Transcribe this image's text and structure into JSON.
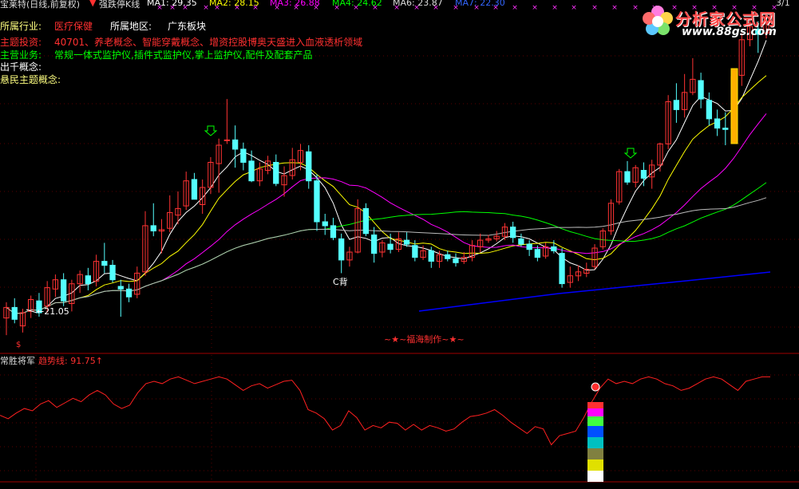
{
  "header": {
    "title": "宝莱特(日线,前复权)",
    "indicator": "强跌停K线",
    "ma1": "MA1: 29.35",
    "ma2": "MA2: 28.15",
    "ma3": "MA3: 26.88",
    "ma4": "MA4: 24.62",
    "ma6": "MA6: 23.87",
    "ma7": "MA7: 22.30",
    "corner": "3/1"
  },
  "info": {
    "industry_label": "所属行业:",
    "industry_value": "医疗保健",
    "region_label": "所属地区:",
    "region_value": "广东板块",
    "theme_label": "主题投资:",
    "theme_value": "40701、养老概念、智能穿戴概念、增资控股博奥天盛进入血液透析领域",
    "business_label": "主营业务:",
    "business_value": "常规一体式监护仪,插件式监护仪,掌上监护仪,配件及配套产品",
    "chuqian_label": "出千概念:",
    "youmin_label": "悬民主题概念:"
  },
  "logo": {
    "name": "分析家公式网",
    "url": "www.88gs.com"
  },
  "annotations": {
    "low_price": "←21.05",
    "c_back": "C背",
    "credit": "~★~福海制作~★~",
    "dollar": "$"
  },
  "lower_panel": {
    "name": "常胜将军",
    "trend_label": "趋势线:",
    "trend_value": "91.75",
    "trend_arrow": "↑"
  },
  "colors": {
    "ma1": "#ffffff",
    "ma2": "#ffff00",
    "ma3": "#ff00ff",
    "ma4": "#00ff00",
    "ma6": "#0000ff",
    "ma7": "#3366ff",
    "up": "#ff3333",
    "down": "#54ffff",
    "industry": "#ff3030",
    "business": "#00ff00",
    "grid": "#800000"
  },
  "chart_data": {
    "type": "candlestick",
    "candles": [
      {
        "o": 23.0,
        "h": 24.2,
        "l": 21.7,
        "c": 23.8
      },
      {
        "o": 23.8,
        "h": 24.5,
        "l": 22.6,
        "c": 22.9
      },
      {
        "o": 22.4,
        "h": 23.7,
        "l": 21.9,
        "c": 23.4
      },
      {
        "o": 23.5,
        "h": 24.7,
        "l": 23.0,
        "c": 24.4
      },
      {
        "o": 24.3,
        "h": 24.9,
        "l": 23.1,
        "c": 23.4
      },
      {
        "o": 23.9,
        "h": 25.8,
        "l": 23.4,
        "c": 25.3
      },
      {
        "o": 25.2,
        "h": 26.3,
        "l": 24.6,
        "c": 25.9
      },
      {
        "o": 25.9,
        "h": 26.4,
        "l": 23.9,
        "c": 24.3
      },
      {
        "o": 24.1,
        "h": 25.9,
        "l": 23.5,
        "c": 25.6
      },
      {
        "o": 25.6,
        "h": 26.6,
        "l": 24.9,
        "c": 26.3
      },
      {
        "o": 26.2,
        "h": 26.8,
        "l": 25.1,
        "c": 25.6
      },
      {
        "o": 25.8,
        "h": 27.8,
        "l": 25.4,
        "c": 27.3
      },
      {
        "o": 27.3,
        "h": 28.7,
        "l": 26.4,
        "c": 27.0
      },
      {
        "o": 27.0,
        "h": 27.4,
        "l": 25.7,
        "c": 25.9
      },
      {
        "o": 25.4,
        "h": 25.9,
        "l": 23.1,
        "c": 25.2
      },
      {
        "o": 25.2,
        "h": 25.6,
        "l": 24.2,
        "c": 24.6
      },
      {
        "o": 24.8,
        "h": 26.9,
        "l": 24.5,
        "c": 26.4
      },
      {
        "o": 26.5,
        "h": 31.1,
        "l": 26.2,
        "c": 30.0
      },
      {
        "o": 30.0,
        "h": 31.7,
        "l": 29.2,
        "c": 29.6
      },
      {
        "o": 29.6,
        "h": 30.5,
        "l": 27.9,
        "c": 29.7
      },
      {
        "o": 29.8,
        "h": 32.3,
        "l": 29.5,
        "c": 31.0
      },
      {
        "o": 30.8,
        "h": 32.6,
        "l": 30.1,
        "c": 31.3
      },
      {
        "o": 31.5,
        "h": 34.1,
        "l": 31.2,
        "c": 33.4
      },
      {
        "o": 33.5,
        "h": 34.0,
        "l": 32.0,
        "c": 32.0
      },
      {
        "o": 31.6,
        "h": 33.5,
        "l": 30.9,
        "c": 32.9
      },
      {
        "o": 32.9,
        "h": 35.2,
        "l": 32.4,
        "c": 34.8
      },
      {
        "o": 34.7,
        "h": 36.6,
        "l": 32.5,
        "c": 36.1
      },
      {
        "o": 36.5,
        "h": 39.6,
        "l": 36.2,
        "c": 36.5
      },
      {
        "o": 36.5,
        "h": 37.6,
        "l": 34.4,
        "c": 35.8
      },
      {
        "o": 35.8,
        "h": 36.3,
        "l": 34.2,
        "c": 34.8
      },
      {
        "o": 34.9,
        "h": 35.7,
        "l": 33.3,
        "c": 33.4
      },
      {
        "o": 33.4,
        "h": 34.8,
        "l": 33.0,
        "c": 34.3
      },
      {
        "o": 34.2,
        "h": 35.3,
        "l": 33.9,
        "c": 34.9
      },
      {
        "o": 34.8,
        "h": 35.4,
        "l": 33.0,
        "c": 33.2
      },
      {
        "o": 33.1,
        "h": 34.5,
        "l": 32.2,
        "c": 33.8
      },
      {
        "o": 33.8,
        "h": 35.9,
        "l": 33.5,
        "c": 35.0
      },
      {
        "o": 34.8,
        "h": 36.2,
        "l": 34.2,
        "c": 35.7
      },
      {
        "o": 35.6,
        "h": 36.1,
        "l": 32.8,
        "c": 33.4
      },
      {
        "o": 33.4,
        "h": 33.9,
        "l": 29.6,
        "c": 30.3
      },
      {
        "o": 30.3,
        "h": 30.9,
        "l": 29.3,
        "c": 30.0
      },
      {
        "o": 30.0,
        "h": 30.6,
        "l": 28.9,
        "c": 29.1
      },
      {
        "o": 29.0,
        "h": 29.4,
        "l": 26.4,
        "c": 27.4
      },
      {
        "o": 27.4,
        "h": 28.4,
        "l": 26.9,
        "c": 28.0
      },
      {
        "o": 28.0,
        "h": 32.0,
        "l": 27.9,
        "c": 31.3
      },
      {
        "o": 31.3,
        "h": 31.7,
        "l": 29.2,
        "c": 29.4
      },
      {
        "o": 29.3,
        "h": 29.9,
        "l": 27.2,
        "c": 27.9
      },
      {
        "o": 28.0,
        "h": 28.9,
        "l": 27.6,
        "c": 28.7
      },
      {
        "o": 28.6,
        "h": 29.4,
        "l": 27.9,
        "c": 28.2
      },
      {
        "o": 28.2,
        "h": 29.5,
        "l": 28.0,
        "c": 29.0
      },
      {
        "o": 28.9,
        "h": 29.5,
        "l": 28.4,
        "c": 28.6
      },
      {
        "o": 28.5,
        "h": 28.9,
        "l": 27.3,
        "c": 27.6
      },
      {
        "o": 27.6,
        "h": 28.5,
        "l": 27.4,
        "c": 28.1
      },
      {
        "o": 28.1,
        "h": 28.4,
        "l": 26.8,
        "c": 27.3
      },
      {
        "o": 27.3,
        "h": 28.1,
        "l": 26.8,
        "c": 27.8
      },
      {
        "o": 27.8,
        "h": 28.1,
        "l": 27.3,
        "c": 27.5
      },
      {
        "o": 27.5,
        "h": 27.9,
        "l": 26.9,
        "c": 27.2
      },
      {
        "o": 27.3,
        "h": 28.0,
        "l": 27.1,
        "c": 27.6
      },
      {
        "o": 27.6,
        "h": 28.9,
        "l": 27.3,
        "c": 28.5
      },
      {
        "o": 28.4,
        "h": 29.4,
        "l": 28.0,
        "c": 28.9
      },
      {
        "o": 28.9,
        "h": 29.3,
        "l": 28.7,
        "c": 29.0
      },
      {
        "o": 29.0,
        "h": 29.6,
        "l": 28.8,
        "c": 29.2
      },
      {
        "o": 29.2,
        "h": 30.2,
        "l": 28.9,
        "c": 29.9
      },
      {
        "o": 29.9,
        "h": 30.3,
        "l": 28.7,
        "c": 29.1
      },
      {
        "o": 29.0,
        "h": 29.4,
        "l": 28.4,
        "c": 28.6
      },
      {
        "o": 28.6,
        "h": 28.9,
        "l": 27.7,
        "c": 28.2
      },
      {
        "o": 28.2,
        "h": 28.5,
        "l": 27.3,
        "c": 27.6
      },
      {
        "o": 27.7,
        "h": 28.7,
        "l": 27.5,
        "c": 28.4
      },
      {
        "o": 28.4,
        "h": 28.9,
        "l": 27.9,
        "c": 28.1
      },
      {
        "o": 27.9,
        "h": 28.3,
        "l": 25.3,
        "c": 25.6
      },
      {
        "o": 25.7,
        "h": 26.9,
        "l": 25.3,
        "c": 26.2
      },
      {
        "o": 26.2,
        "h": 27.0,
        "l": 25.8,
        "c": 26.5
      },
      {
        "o": 26.4,
        "h": 27.2,
        "l": 26.1,
        "c": 26.7
      },
      {
        "o": 26.9,
        "h": 28.6,
        "l": 26.7,
        "c": 28.3
      },
      {
        "o": 28.4,
        "h": 29.8,
        "l": 28.2,
        "c": 29.6
      },
      {
        "o": 29.6,
        "h": 32.0,
        "l": 29.3,
        "c": 31.7
      },
      {
        "o": 31.8,
        "h": 34.3,
        "l": 31.6,
        "c": 34.1
      },
      {
        "o": 34.1,
        "h": 34.9,
        "l": 33.1,
        "c": 33.3
      },
      {
        "o": 33.3,
        "h": 34.6,
        "l": 32.9,
        "c": 34.4
      },
      {
        "o": 34.2,
        "h": 34.8,
        "l": 33.0,
        "c": 33.6
      },
      {
        "o": 33.7,
        "h": 35.0,
        "l": 32.8,
        "c": 34.6
      },
      {
        "o": 34.6,
        "h": 36.3,
        "l": 34.1,
        "c": 36.2
      },
      {
        "o": 36.2,
        "h": 39.9,
        "l": 35.8,
        "c": 39.4
      },
      {
        "o": 39.5,
        "h": 40.8,
        "l": 37.8,
        "c": 38.8
      },
      {
        "o": 38.8,
        "h": 41.5,
        "l": 38.2,
        "c": 40.1
      },
      {
        "o": 40.1,
        "h": 42.7,
        "l": 39.9,
        "c": 41.1
      },
      {
        "o": 41.0,
        "h": 41.6,
        "l": 38.9,
        "c": 39.6
      },
      {
        "o": 39.5,
        "h": 40.1,
        "l": 37.6,
        "c": 38.1
      },
      {
        "o": 38.1,
        "h": 38.8,
        "l": 36.8,
        "c": 37.4
      },
      {
        "o": 37.4,
        "h": 38.6,
        "l": 36.1,
        "c": 37.3
      },
      {
        "o": 37.4,
        "h": 41.9,
        "l": 37.2,
        "c": 41.3
      },
      {
        "o": 41.4,
        "h": 44.6,
        "l": 40.6,
        "c": 44.1
      },
      {
        "o": 44.1,
        "h": 45.6,
        "l": 43.6,
        "c": 45.1
      },
      {
        "o": 44.9,
        "h": 45.5,
        "l": 43.1,
        "c": 44.5
      },
      {
        "o": 44.6,
        "h": 45.9,
        "l": 44.2,
        "c": 45.3
      }
    ],
    "price_range": [
      20.5,
      45.9
    ],
    "trend_range": [
      0,
      100
    ],
    "trend_line": [
      58,
      55,
      60,
      64,
      62,
      68,
      71,
      65,
      69,
      73,
      70,
      76,
      80,
      76,
      68,
      64,
      67,
      78,
      86,
      88,
      86,
      90,
      92,
      89,
      86,
      88,
      90,
      92,
      90,
      85,
      80,
      84,
      86,
      82,
      85,
      88,
      89,
      80,
      63,
      60,
      55,
      45,
      49,
      62,
      56,
      45,
      49,
      47,
      52,
      51,
      45,
      50,
      45,
      49,
      47,
      44,
      46,
      52,
      57,
      58,
      60,
      63,
      58,
      52,
      47,
      42,
      48,
      46,
      32,
      40,
      42,
      44,
      56,
      70,
      82,
      90,
      86,
      88,
      86,
      90,
      92,
      90,
      86,
      84,
      80,
      82,
      86,
      90,
      92,
      90,
      85,
      80,
      88,
      90,
      92,
      92
    ]
  }
}
